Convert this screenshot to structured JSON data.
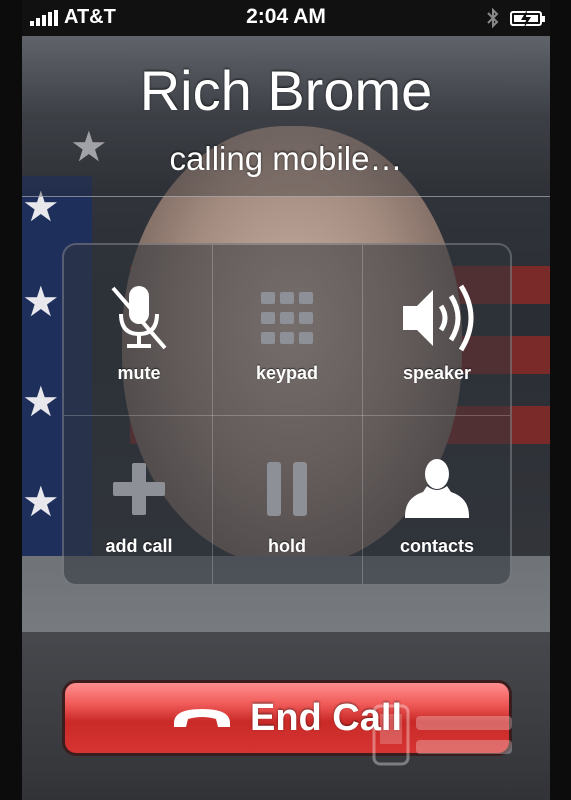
{
  "status_bar": {
    "carrier": "AT&T",
    "time": "2:04 AM",
    "signal_icon": "signal-bars-icon",
    "bluetooth_icon": "bluetooth-icon",
    "battery_icon": "battery-charging-icon"
  },
  "call": {
    "contact_name": "Rich Brome",
    "status": "calling mobile…"
  },
  "buttons": [
    {
      "label": "mute",
      "icon": "microphone-muted-icon"
    },
    {
      "label": "keypad",
      "icon": "keypad-icon"
    },
    {
      "label": "speaker",
      "icon": "speaker-icon"
    },
    {
      "label": "add call",
      "icon": "plus-icon"
    },
    {
      "label": "hold",
      "icon": "pause-icon"
    },
    {
      "label": "contacts",
      "icon": "person-icon"
    }
  ],
  "end_call": {
    "label": "End Call",
    "icon": "phone-hangup-icon",
    "color": "#d63432"
  },
  "watermark": {
    "icon": "phone-scoop-logo"
  }
}
